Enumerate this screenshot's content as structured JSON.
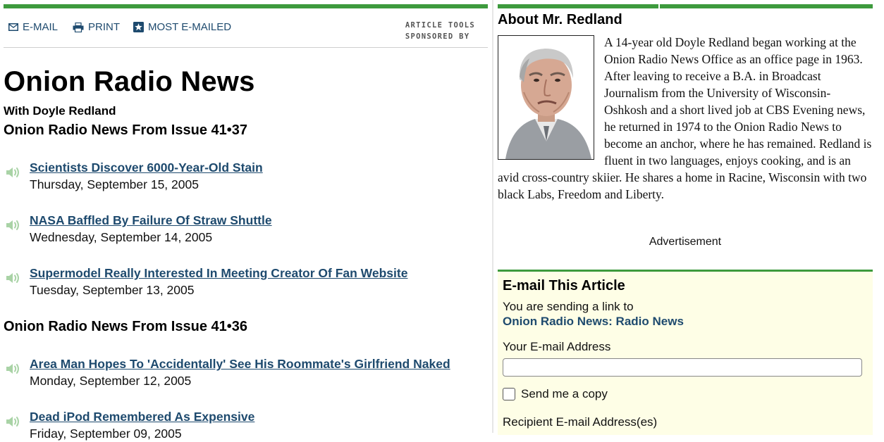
{
  "colors": {
    "accent_green": "#3d9a3d",
    "link_blue": "#1e4a6e",
    "email_box_bg": "#fefee6"
  },
  "tools": {
    "email_label": "E-MAIL",
    "email_icon": "envelope-icon",
    "print_label": "PRINT",
    "print_icon": "printer-icon",
    "most_emailed_label": "MOST E-MAILED",
    "most_emailed_icon": "star-icon",
    "sponsor_line1": "ARTICLE TOOLS",
    "sponsor_line2": "SPONSORED BY"
  },
  "page": {
    "title": "Onion Radio News",
    "byline": "With Doyle Redland"
  },
  "issues": [
    {
      "heading": "Onion Radio News From Issue 41•37",
      "stories": [
        {
          "title": "Scientists Discover 6000-Year-Old Stain",
          "date": "Thursday, September 15, 2005"
        },
        {
          "title": "NASA Baffled By Failure Of Straw Shuttle",
          "date": "Wednesday, September 14, 2005"
        },
        {
          "title": "Supermodel Really Interested In Meeting Creator Of Fan Website",
          "date": "Tuesday, September 13, 2005"
        }
      ]
    },
    {
      "heading": "Onion Radio News From Issue 41•36",
      "stories": [
        {
          "title": "Area Man Hopes To 'Accidentally' See His Roommate's Girlfriend Naked",
          "date": "Monday, September 12, 2005"
        },
        {
          "title": "Dead iPod Remembered As Expensive",
          "date": "Friday, September 09, 2005"
        }
      ]
    }
  ],
  "about": {
    "title": "About Mr. Redland",
    "body": "A 14-year old Doyle Redland began working at the Onion Radio News Office as an office page in 1963. After leaving to receive a B.A. in Broadcast Journalism from the University of Wisconsin-Oshkosh and a short lived job at CBS Evening news, he returned in 1974 to the Onion Radio News to become an anchor, where he has remained. Redland is fluent in two languages, enjoys cooking, and is an avid cross-country skiier. He shares a home in Racine, Wisconsin with two black Labs, Freedom and Liberty."
  },
  "advertisement_label": "Advertisement",
  "email_form": {
    "title": "E-mail This Article",
    "sending_text": "You are sending a link to",
    "article_name": "Onion Radio News: Radio News",
    "your_email_label": "Your E-mail Address",
    "your_email_value": "",
    "send_copy_label": "Send me a copy",
    "send_copy_checked": false,
    "recipient_label": "Recipient E-mail Address(es)"
  }
}
